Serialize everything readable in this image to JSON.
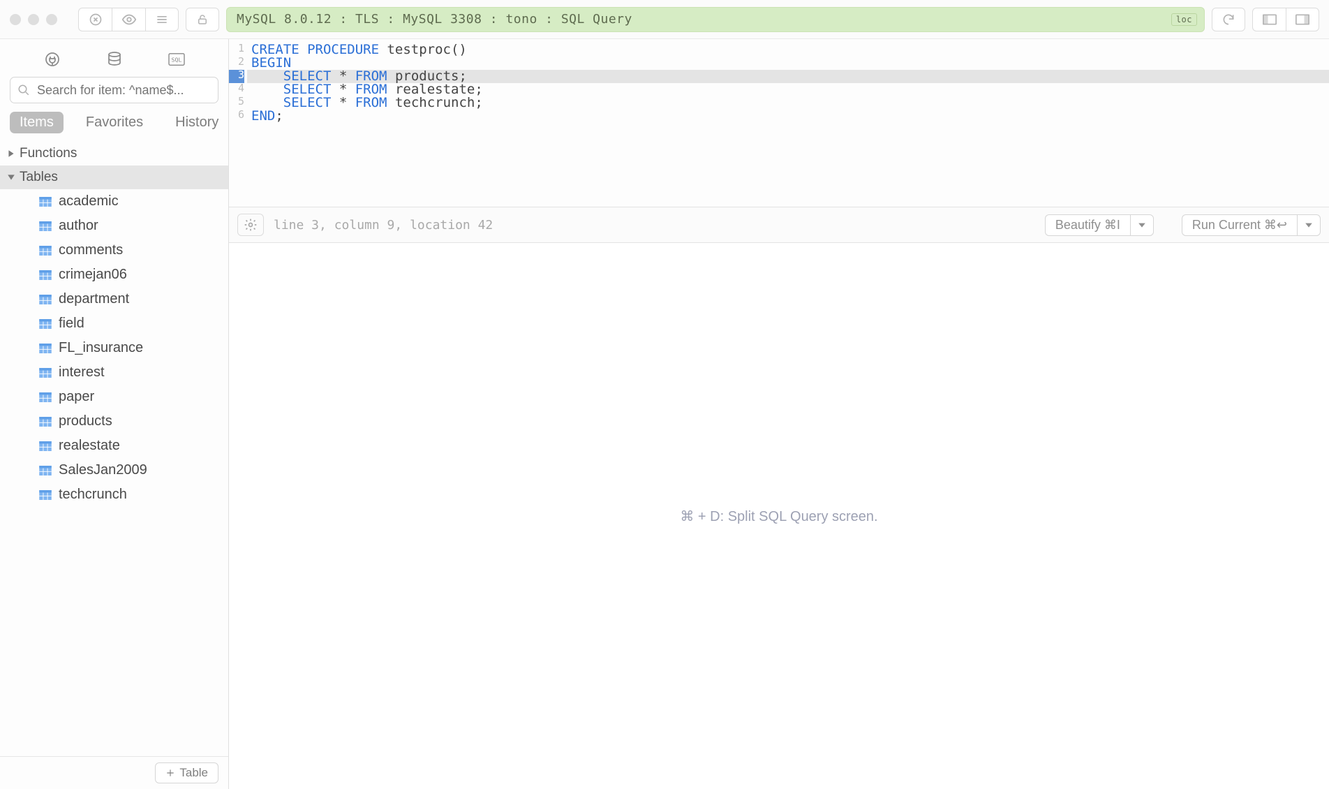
{
  "toolbar": {
    "connection_string": "MySQL 8.0.12 : TLS : MySQL 3308 : tono : SQL Query",
    "connection_tag": "loc",
    "icons": {
      "close": "close-icon",
      "eye": "eye-icon",
      "lines": "list-icon",
      "lock": "lock-icon",
      "refresh": "refresh-icon",
      "pane_left": "pane-left-icon",
      "pane_right": "pane-right-icon"
    }
  },
  "sidebar": {
    "icons": {
      "plug": "plug-icon",
      "database": "database-icon",
      "sql": "sql-icon"
    },
    "search_placeholder": "Search for item: ^name$...",
    "tabs": [
      "Items",
      "Favorites",
      "History"
    ],
    "active_tab": 0,
    "sections": {
      "functions_label": "Functions",
      "tables_label": "Tables"
    },
    "tables": [
      "academic",
      "author",
      "comments",
      "crimejan06",
      "department",
      "field",
      "FL_insurance",
      "interest",
      "paper",
      "products",
      "realestate",
      "SalesJan2009",
      "techcrunch"
    ],
    "add_button": "Table"
  },
  "editor": {
    "lines": [
      {
        "n": "1",
        "hl": false,
        "tokens": [
          [
            "kw",
            "CREATE PROCEDURE"
          ],
          [
            "plain",
            " testproc()"
          ]
        ]
      },
      {
        "n": "2",
        "hl": false,
        "tokens": [
          [
            "kw",
            "BEGIN"
          ]
        ]
      },
      {
        "n": "3",
        "hl": true,
        "tokens": [
          [
            "plain",
            "    "
          ],
          [
            "kw",
            "SELECT"
          ],
          [
            "plain",
            " * "
          ],
          [
            "kw",
            "FROM"
          ],
          [
            "plain",
            " products;"
          ]
        ]
      },
      {
        "n": "4",
        "hl": false,
        "tokens": [
          [
            "plain",
            "    "
          ],
          [
            "kw",
            "SELECT"
          ],
          [
            "plain",
            " * "
          ],
          [
            "kw",
            "FROM"
          ],
          [
            "plain",
            " realestate;"
          ]
        ]
      },
      {
        "n": "5",
        "hl": false,
        "tokens": [
          [
            "plain",
            "    "
          ],
          [
            "kw",
            "SELECT"
          ],
          [
            "plain",
            " * "
          ],
          [
            "kw",
            "FROM"
          ],
          [
            "plain",
            " techcrunch;"
          ]
        ]
      },
      {
        "n": "6",
        "hl": false,
        "tokens": [
          [
            "kw",
            "END"
          ],
          [
            "plain",
            ";"
          ]
        ]
      }
    ],
    "status": "line 3, column 9, location 42",
    "beautify_label": "Beautify ⌘I",
    "run_label": "Run Current ⌘↩"
  },
  "results": {
    "hint": "⌘ + D: Split SQL Query screen."
  }
}
